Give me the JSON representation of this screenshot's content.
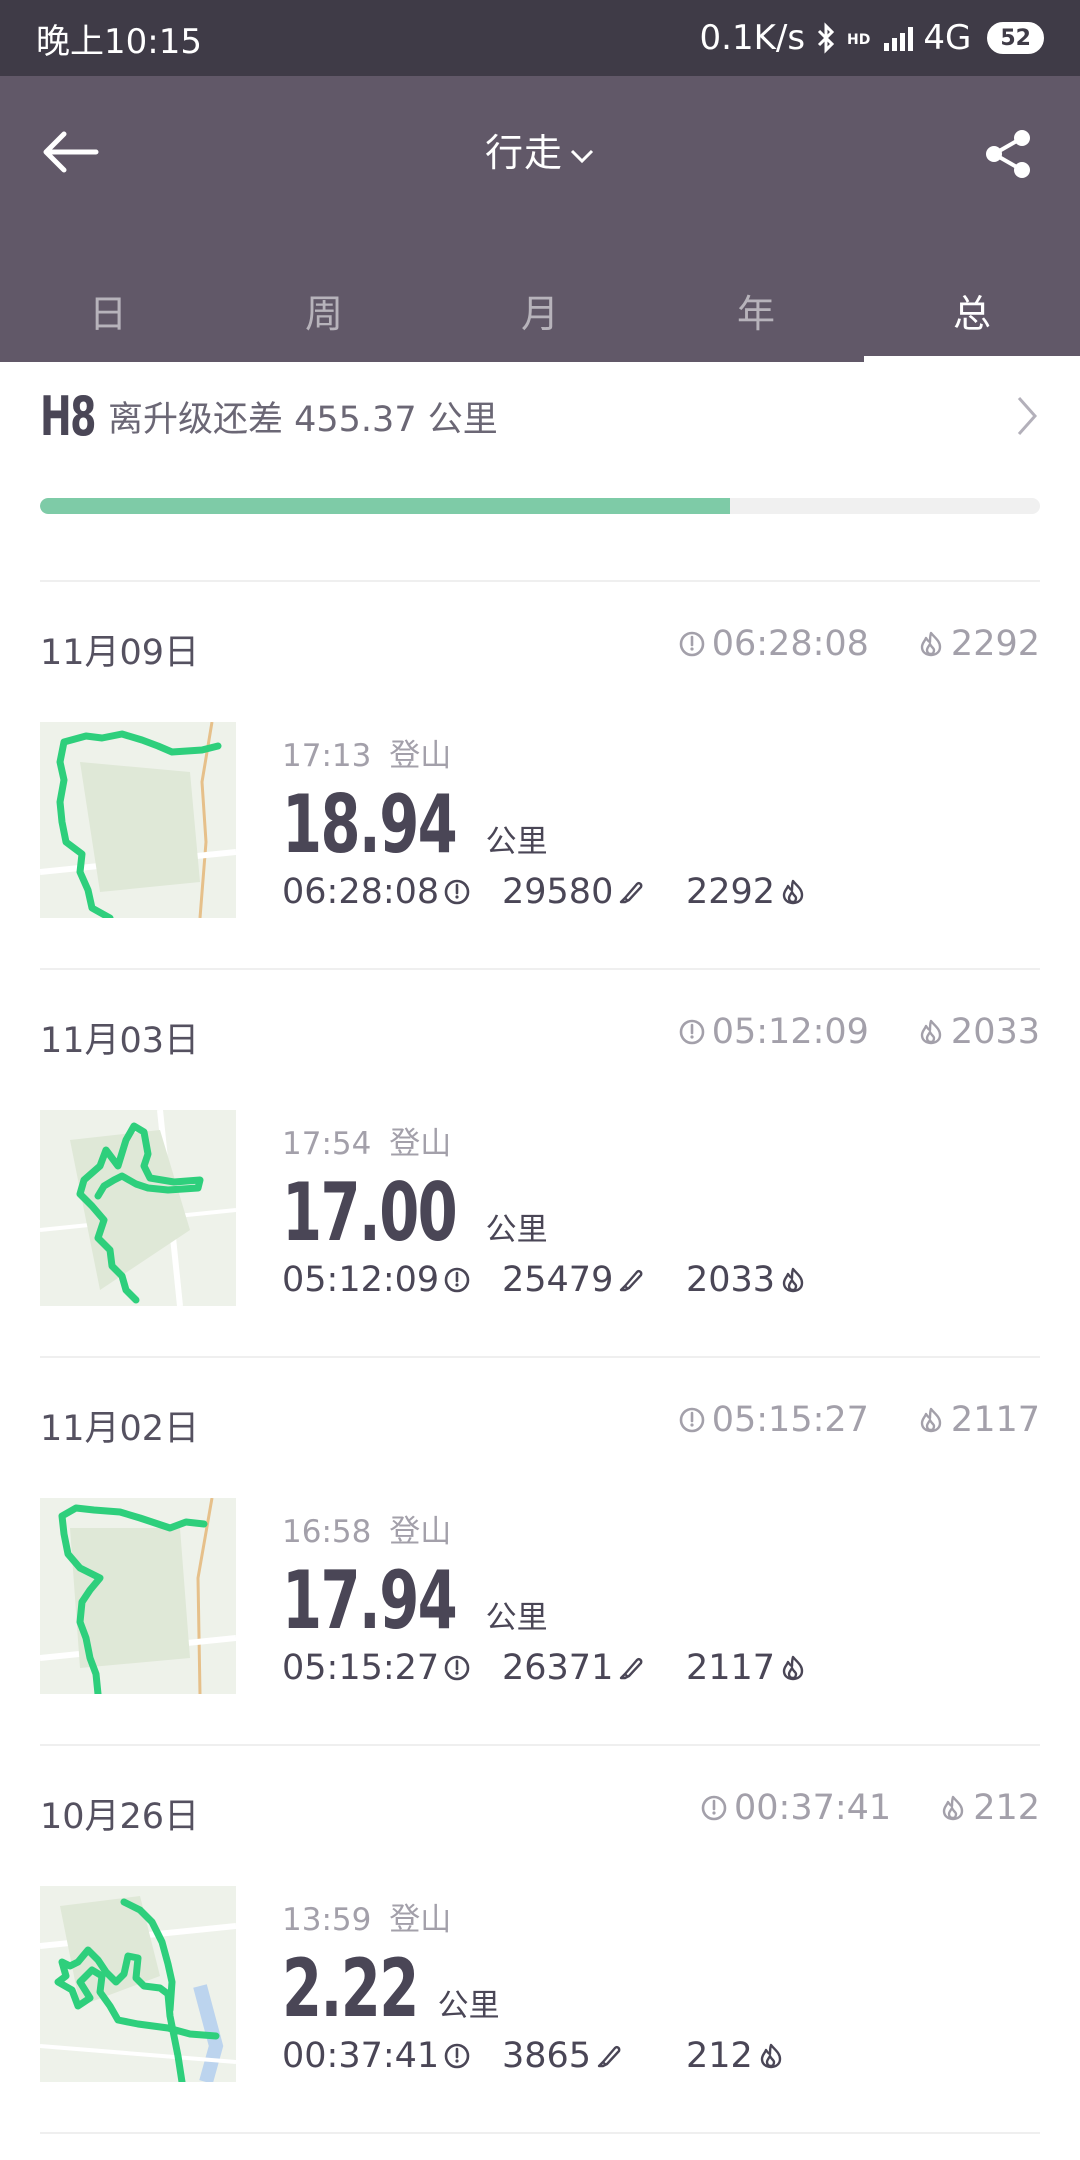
{
  "status_bar": {
    "time": "晚上10:15",
    "speed": "0.1K/s",
    "hd": "HD",
    "network": "4G",
    "battery": "52"
  },
  "header": {
    "title": "行走",
    "tabs": [
      {
        "label": "日",
        "active": false
      },
      {
        "label": "周",
        "active": false
      },
      {
        "label": "月",
        "active": false
      },
      {
        "label": "年",
        "active": false
      },
      {
        "label": "总",
        "active": true
      }
    ]
  },
  "level": {
    "badge": "H8",
    "text": "离升级还差 455.37 公里",
    "progress": 0.69
  },
  "colors": {
    "status_bar_bg": "#3f3b47",
    "header_bg": "#615868",
    "accent_green": "#7ecba7",
    "route_green": "#2ecf7c"
  },
  "records": [
    {
      "date": "11月09日",
      "total_duration": "06:28:08",
      "total_calories": "2292",
      "time": "17:13",
      "activity": "登山",
      "distance": "18.94",
      "unit": "公里",
      "duration": "06:28:08",
      "steps": "29580",
      "calories": "2292"
    },
    {
      "date": "11月03日",
      "total_duration": "05:12:09",
      "total_calories": "2033",
      "time": "17:54",
      "activity": "登山",
      "distance": "17.00",
      "unit": "公里",
      "duration": "05:12:09",
      "steps": "25479",
      "calories": "2033"
    },
    {
      "date": "11月02日",
      "total_duration": "05:15:27",
      "total_calories": "2117",
      "time": "16:58",
      "activity": "登山",
      "distance": "17.94",
      "unit": "公里",
      "duration": "05:15:27",
      "steps": "26371",
      "calories": "2117"
    },
    {
      "date": "10月26日",
      "total_duration": "00:37:41",
      "total_calories": "212",
      "time": "13:59",
      "activity": "登山",
      "distance": "2.22",
      "unit": "公里",
      "duration": "00:37:41",
      "steps": "3865",
      "calories": "212"
    }
  ]
}
